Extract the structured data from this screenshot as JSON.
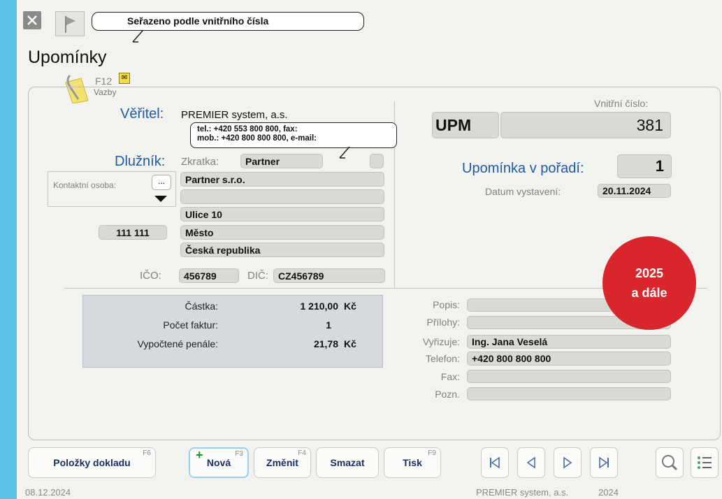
{
  "toolbar": {
    "close_icon": "close-icon",
    "flag_icon": "flag-icon",
    "sort_tooltip": "Seřazeno podle vnitřního čísla"
  },
  "page": {
    "title": "Upomínky"
  },
  "links": {
    "fkey": "F12",
    "label": "Vazby"
  },
  "creditor": {
    "label": "Věřitel:",
    "name": "PREMIER system, a.s.",
    "contact_line1": "tel.: +420 553 800 800, fax:",
    "contact_line2": "mob.: +420 800 800 800, e-mail:"
  },
  "debtor": {
    "label": "Dlužník:",
    "abbr_label": "Zkratka:",
    "abbr": "Partner",
    "contact_label": "Kontaktní osoba:",
    "contact_button": "...",
    "name": "Partner s.r.o.",
    "line2": "",
    "street": "Ulice 10",
    "zip": "111 111",
    "city": "Město",
    "country": "Česká republika",
    "ico_label": "IČO:",
    "ico": "456789",
    "dic_label": "DIČ:",
    "dic": "CZ456789"
  },
  "doc": {
    "type": "UPM",
    "internal_label": "Vnitřní číslo:",
    "internal_number": "381",
    "order_label": "Upomínka v pořadí:",
    "order": "1",
    "date_label": "Datum vystavení:",
    "date": "20.11.2024"
  },
  "summary": {
    "amount_label": "Částka:",
    "amount": "1 210,00",
    "currency": "Kč",
    "invoices_label": "Počet faktur:",
    "invoices": "1",
    "penalty_label": "Vypočtené penále:",
    "penalty": "21,78",
    "penalty_currency": "Kč"
  },
  "details": {
    "popis_label": "Popis:",
    "popis": "",
    "prilohy_label": "Přílohy:",
    "prilohy": "",
    "vyrizuje_label": "Vyřizuje:",
    "vyrizuje": "Ing. Jana Veselá",
    "telefon_label": "Telefon:",
    "telefon": "+420 800 800 800",
    "fax_label": "Fax:",
    "fax": "",
    "pozn_label": "Pozn.",
    "pozn": ""
  },
  "badge": {
    "line1": "2025",
    "line2": "a dále",
    "color": "#d9262c"
  },
  "buttons": {
    "items": {
      "label": "Položky dokladu",
      "fkey": "F6"
    },
    "new": {
      "label": "Nová",
      "fkey": "F3"
    },
    "edit": {
      "label": "Změnit",
      "fkey": "F4"
    },
    "delete": {
      "label": "Smazat"
    },
    "print": {
      "label": "Tisk",
      "fkey": "F9"
    }
  },
  "status": {
    "date": "08.12.2024",
    "company": "PREMIER system, a.s.",
    "year": "2024"
  }
}
